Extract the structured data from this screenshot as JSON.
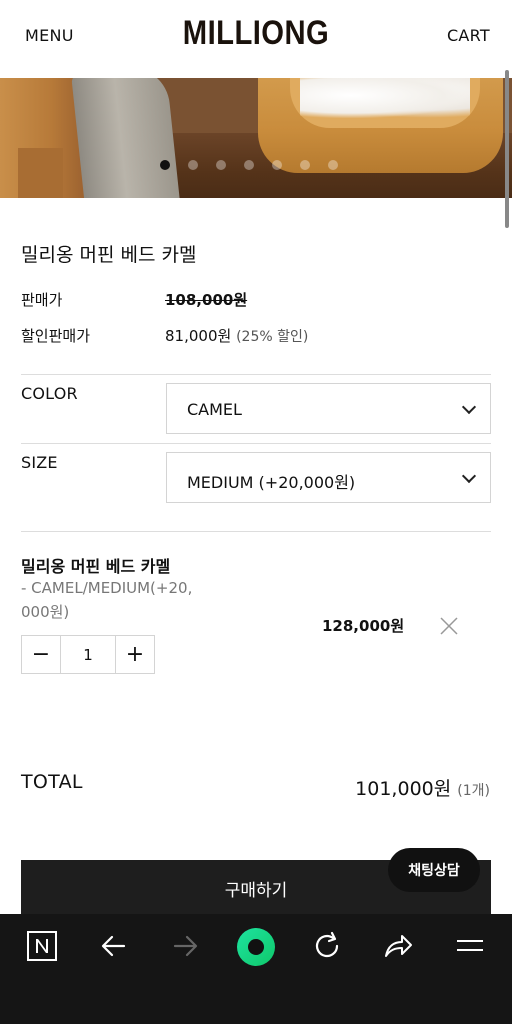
{
  "header": {
    "menu_label": "MENU",
    "logo_text": "MILLIONG",
    "cart_label": "CART"
  },
  "hero": {
    "slide_count": 7,
    "active_slide": 1
  },
  "product": {
    "title": "밀리옹 머핀 베드 카멜",
    "price_label": "판매가",
    "price": "108,000원",
    "sale_label": "할인판매가",
    "sale_price": "81,000원",
    "discount": "(25% 할인)"
  },
  "options": {
    "color_label": "COLOR",
    "color_value": "CAMEL",
    "size_label": "SIZE",
    "size_value": "MEDIUM (+20,000원)"
  },
  "selected": {
    "name": "밀리옹 머핀 베드 카멜",
    "option_line1": "- CAMEL/MEDIUM(+20,",
    "option_line2": "000원)",
    "quantity": "1",
    "minus": "−",
    "plus": "+",
    "price": "128,000원"
  },
  "total": {
    "label": "TOTAL",
    "value": "101,000원",
    "count": "(1개)"
  },
  "buy_label": "구매하기",
  "chat_label": "채팅상담",
  "navbar": {
    "icons": [
      "naver-icon",
      "back-icon",
      "forward-icon",
      "home-icon",
      "refresh-icon",
      "share-icon",
      "hamburger-icon"
    ]
  }
}
